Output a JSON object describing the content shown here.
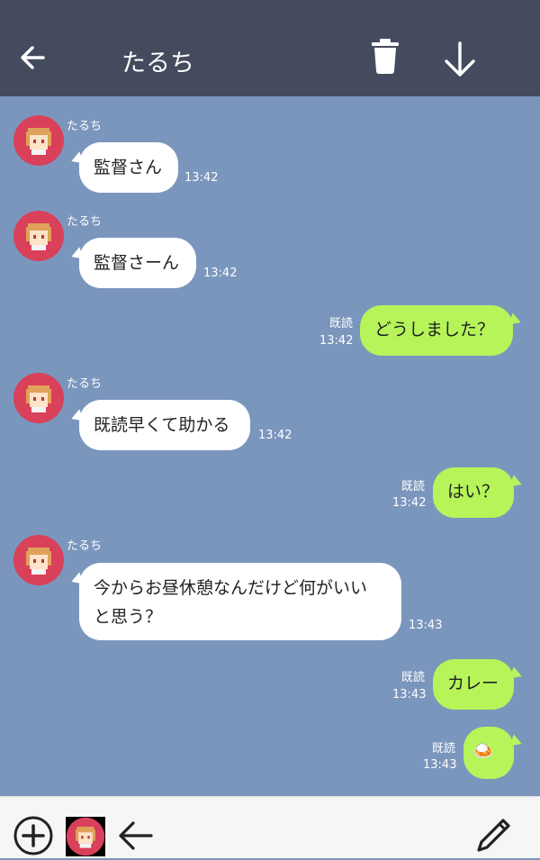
{
  "header": {
    "title": "たるち",
    "back_icon": "arrow-left-icon",
    "trash_icon": "trash-icon",
    "download_icon": "arrow-down-icon"
  },
  "messages": [
    {
      "side": "in",
      "sender": "たるち",
      "text": "監督さん",
      "time": "13:42"
    },
    {
      "side": "in",
      "sender": "たるち",
      "text": "監督さーん",
      "time": "13:42"
    },
    {
      "side": "out",
      "read": "既読",
      "text": "どうしました？",
      "time": "13:42"
    },
    {
      "side": "in",
      "sender": "たるち",
      "text": "既読早くて助かる",
      "time": "13:42"
    },
    {
      "side": "out",
      "read": "既読",
      "text": "はい？",
      "time": "13:42"
    },
    {
      "side": "in",
      "sender": "たるち",
      "text_line1": "今からお昼休憩なんだけど何がいい",
      "text_line2": "と思う？",
      "time": "13:43"
    },
    {
      "side": "out",
      "read": "既読",
      "text": "カレー",
      "time": "13:43"
    },
    {
      "side": "out",
      "read": "既読",
      "text": "🍛",
      "time": "13:43"
    }
  ],
  "footer": {
    "add_icon": "plus-circle-icon",
    "avatar_icon": "avatar-switch-icon",
    "back_icon": "arrow-left-icon",
    "pen_icon": "pencil-icon"
  },
  "colors": {
    "header_bg": "#444b5e",
    "chat_bg": "#7b96bd",
    "outgoing_bubble": "#b6f45a",
    "incoming_bubble": "#ffffff",
    "avatar_bg": "#d9405a"
  }
}
